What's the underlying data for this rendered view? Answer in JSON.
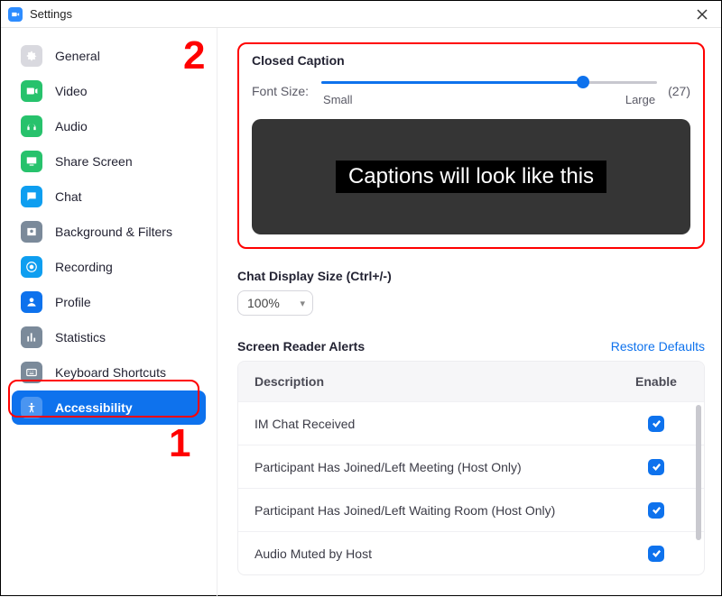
{
  "window": {
    "title": "Settings"
  },
  "annotations": {
    "n1": "1",
    "n2": "2"
  },
  "sidebar": {
    "items": [
      {
        "label": "General",
        "icon": "gear-icon",
        "color": "#d9d9df"
      },
      {
        "label": "Video",
        "icon": "video-icon",
        "color": "#27c26c"
      },
      {
        "label": "Audio",
        "icon": "audio-icon",
        "color": "#27c26c"
      },
      {
        "label": "Share Screen",
        "icon": "share-screen-icon",
        "color": "#27c26c"
      },
      {
        "label": "Chat",
        "icon": "chat-icon",
        "color": "#0e9ef0"
      },
      {
        "label": "Background & Filters",
        "icon": "background-icon",
        "color": "#7b8a9a"
      },
      {
        "label": "Recording",
        "icon": "recording-icon",
        "color": "#0e9ef0"
      },
      {
        "label": "Profile",
        "icon": "profile-icon",
        "color": "#0e72ed"
      },
      {
        "label": "Statistics",
        "icon": "statistics-icon",
        "color": "#7b8a9a"
      },
      {
        "label": "Keyboard Shortcuts",
        "icon": "keyboard-icon",
        "color": "#7b8a9a"
      },
      {
        "label": "Accessibility",
        "icon": "accessibility-icon",
        "color": "#0e72ed",
        "active": true
      }
    ]
  },
  "cc": {
    "title": "Closed Caption",
    "slider_label": "Font Size:",
    "min_label": "Small",
    "max_label": "Large",
    "value_display": "(27)",
    "percent": 78,
    "preview_text": "Captions will look like this"
  },
  "chat_size": {
    "title": "Chat Display Size (Ctrl+/-)",
    "value": "100%"
  },
  "alerts": {
    "title": "Screen Reader Alerts",
    "restore": "Restore Defaults",
    "col_desc": "Description",
    "col_enable": "Enable",
    "rows": [
      {
        "desc": "IM Chat Received",
        "enabled": true
      },
      {
        "desc": "Participant Has Joined/Left Meeting (Host Only)",
        "enabled": true
      },
      {
        "desc": "Participant Has Joined/Left Waiting Room (Host Only)",
        "enabled": true
      },
      {
        "desc": "Audio Muted by Host",
        "enabled": true
      }
    ]
  }
}
